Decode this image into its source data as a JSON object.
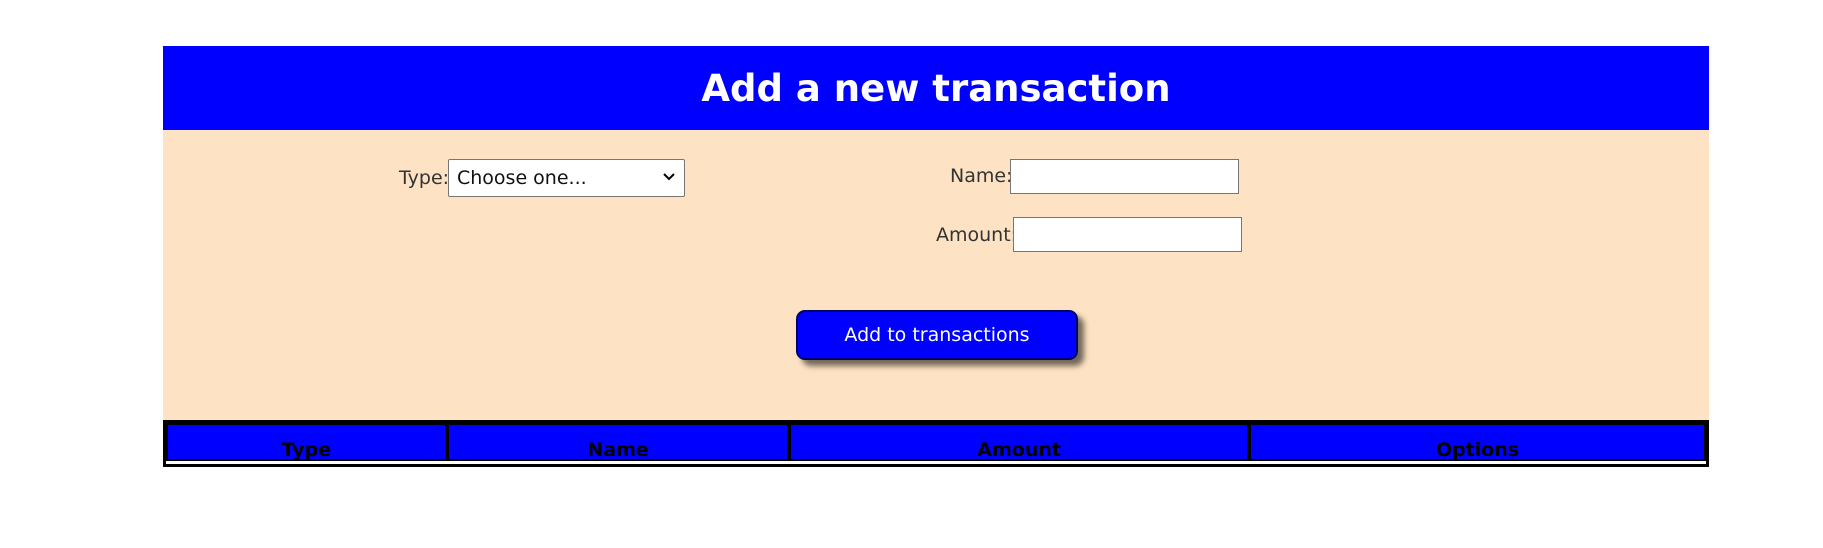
{
  "colors": {
    "header_bg": "#0000ff",
    "panel_bg": "#fde3c3",
    "button_bg": "#0000ff",
    "table_header_bg": "#0000ff"
  },
  "header": {
    "title": "Add a new transaction"
  },
  "form": {
    "type_label": "Type:",
    "type_select_value": "Choose one...",
    "name_label": "Name:",
    "name_value": "",
    "amount_label": "Amount:",
    "amount_value": "",
    "submit_label": "Add to transactions"
  },
  "table": {
    "columns": [
      "Type",
      "Name",
      "Amount",
      "Options"
    ]
  },
  "icons": {
    "select_arrow": "chevron-down-icon"
  }
}
